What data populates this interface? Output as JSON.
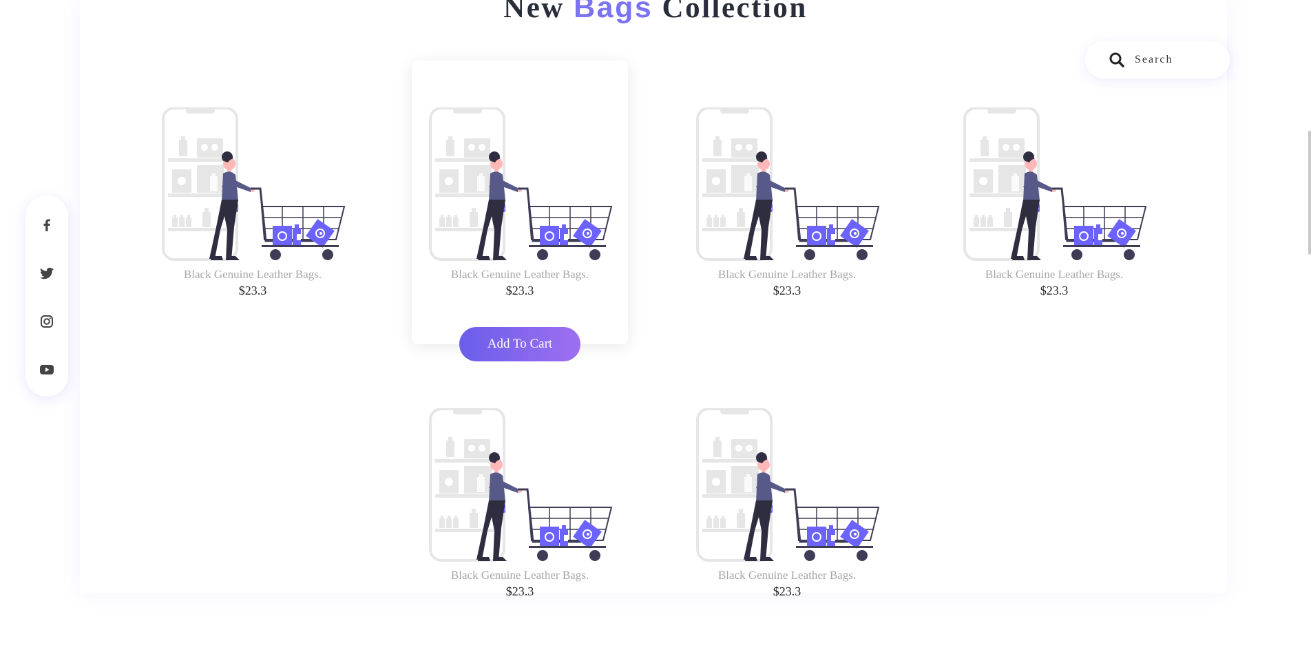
{
  "page": {
    "heading": {
      "before": "New ",
      "accent": "Bags",
      "after": " Collection"
    },
    "accent_color": "#7b74f2",
    "button_gradient": [
      "#6a5eea",
      "#9e6ff0"
    ]
  },
  "search": {
    "placeholder": "Search",
    "icon": "search-icon"
  },
  "social": [
    {
      "name": "facebook",
      "icon": "facebook-icon"
    },
    {
      "name": "twitter",
      "icon": "twitter-icon"
    },
    {
      "name": "instagram",
      "icon": "instagram-icon"
    },
    {
      "name": "youtube",
      "icon": "youtube-icon"
    }
  ],
  "products": [
    {
      "name": "Black Genuine Leather Bags.",
      "price": "$23.3",
      "image": "shopping-cart-illustration"
    },
    {
      "name": "Black Genuine Leather Bags.",
      "price": "$23.3",
      "image": "shopping-cart-illustration",
      "action_label": "Add To Cart"
    },
    {
      "name": "Black Genuine Leather Bags.",
      "price": "$23.3",
      "image": "shopping-cart-illustration"
    },
    {
      "name": "Black Genuine Leather Bags.",
      "price": "$23.3",
      "image": "shopping-cart-illustration"
    },
    {
      "name": "Black Genuine Leather Bags.",
      "price": "$23.3",
      "image": "shopping-cart-illustration"
    },
    {
      "name": "Black Genuine Leather Bags.",
      "price": "$23.3",
      "image": "shopping-cart-illustration"
    }
  ]
}
